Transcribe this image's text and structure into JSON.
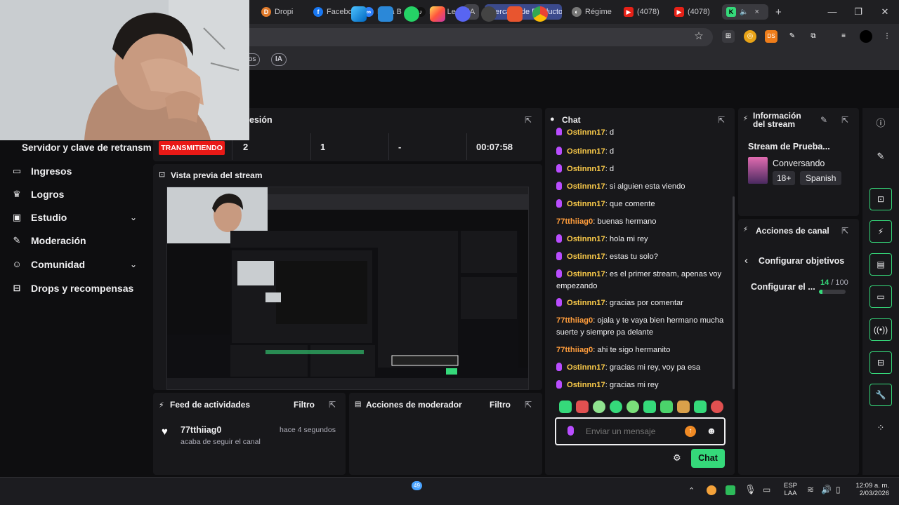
{
  "browser": {
    "tabs": [
      {
        "label": "Dropi",
        "color": "#e07a2b",
        "glyph": "D"
      },
      {
        "label": "Facebo",
        "color": "#1877f2",
        "glyph": "f"
      },
      {
        "label": "Meta B",
        "color": "#2d7ff9",
        "glyph": "∞"
      },
      {
        "label": "Next Le",
        "color": "#111111",
        "glyph": "♪"
      },
      {
        "label": "IA",
        "color": "#44444a",
        "glyph": ""
      },
      {
        "label": "Mercado de Producto",
        "color": "#3b4a8c",
        "glyph": ""
      },
      {
        "label": "Régime",
        "color": "#777777",
        "glyph": "◐"
      },
      {
        "label": "(4078)",
        "color": "#e62117",
        "glyph": "▶"
      },
      {
        "label": "(4078)",
        "color": "#e62117",
        "glyph": "▶"
      }
    ],
    "active_tab_close": "×",
    "new_tab": "+",
    "window_controls": {
      "minimize": "—",
      "restore": "❐",
      "close": "✕"
    },
    "bookmarks": {
      "chip1": "ctos",
      "chip2": "IA"
    },
    "toolbar_icons": {
      "star": "☆",
      "ds": "DS"
    }
  },
  "camera_overlay": {
    "visible": true
  },
  "session_bar": {
    "title": "esión",
    "server_label": "Servidor y clave de retransm",
    "status_badge": "TRANSMITIENDO",
    "stats": [
      "2",
      "1",
      "-",
      "00:07:58"
    ]
  },
  "sidebar": {
    "items": [
      {
        "label": "Ingresos",
        "icon": "▭",
        "has_chevron": false
      },
      {
        "label": "Logros",
        "icon": "🏆",
        "has_chevron": false
      },
      {
        "label": "Estudio",
        "icon": "▣",
        "has_chevron": true
      },
      {
        "label": "Moderación",
        "icon": "🔧",
        "has_chevron": false
      },
      {
        "label": "Comunidad",
        "icon": "👥",
        "has_chevron": true
      },
      {
        "label": "Drops y recompensas",
        "icon": "🎁",
        "has_chevron": false
      }
    ]
  },
  "preview": {
    "title": "Vista previa del stream"
  },
  "activity_feed": {
    "title": "Feed de actividades",
    "filter_label": "Filtro",
    "items": [
      {
        "user": "77tthiiag0",
        "action": "acaba de seguir el canal",
        "time": "hace 4 segundos"
      }
    ]
  },
  "mod_actions": {
    "title": "Acciones de moderador",
    "filter_label": "Filtro"
  },
  "chat": {
    "title": "Chat",
    "messages": [
      {
        "user": "Ostinnn17",
        "text": "d",
        "color": "#ffce4a",
        "badge": true
      },
      {
        "user": "Ostinnn17",
        "text": "d",
        "color": "#ffce4a",
        "badge": true
      },
      {
        "user": "Ostinnn17",
        "text": "d",
        "color": "#ffce4a",
        "badge": true
      },
      {
        "user": "Ostinnn17",
        "text": "si alguien esta viendo",
        "color": "#ffce4a",
        "badge": true
      },
      {
        "user": "Ostinnn17",
        "text": "que comente",
        "color": "#ffce4a",
        "badge": true
      },
      {
        "user": "77tthiiag0",
        "text": "buenas hermano",
        "color": "#ff9d3c",
        "badge": false
      },
      {
        "user": "Ostinnn17",
        "text": "hola mi rey",
        "color": "#ffce4a",
        "badge": true
      },
      {
        "user": "Ostinnn17",
        "text": "estas tu solo?",
        "color": "#ffce4a",
        "badge": true
      },
      {
        "user": "Ostinnn17",
        "text": "es el primer stream, apenas voy empezando",
        "color": "#ffce4a",
        "badge": true
      },
      {
        "user": "Ostinnn17",
        "text": "gracias por comentar",
        "color": "#ffce4a",
        "badge": true
      },
      {
        "user": "77tthiiag0",
        "text": "ojala y te vaya bien hermano mucha suerte y siempre pa delante",
        "color": "#ff9d3c",
        "badge": false
      },
      {
        "user": "77tthiiag0",
        "text": "ahi te sigo hermanito",
        "color": "#ff9d3c",
        "badge": false
      },
      {
        "user": "Ostinnn17",
        "text": "gracias mi rey, voy pa esa",
        "color": "#ffce4a",
        "badge": true
      },
      {
        "user": "Ostinnn17",
        "text": "gracias mi rey",
        "color": "#ffce4a",
        "badge": true
      }
    ],
    "input_placeholder": "Enviar un mensaje",
    "send_label": "Chat"
  },
  "stream_info": {
    "title_line1": "Información",
    "title_line2": "del stream",
    "stream_title": "Stream de Prueba...",
    "category": "Conversando",
    "tags": [
      "18+",
      "Spanish"
    ]
  },
  "channel_actions": {
    "title": "Acciones de canal",
    "back_label": "Configurar objetivos",
    "goal_label": "Configurar el ...",
    "goal_current": "14",
    "goal_total": "/ 100",
    "goal_progress": 0.14
  },
  "taskbar": {
    "whatsapp_badge": "49",
    "lang_top": "ESP",
    "lang_bottom": "LAA",
    "time": "12:09 a. m.",
    "date": "2/03/2026"
  },
  "colors": {
    "accent": "#35d97a",
    "live_red": "#e91916",
    "twitch_bg": "#0e0e10",
    "panel_bg": "#18181b"
  }
}
